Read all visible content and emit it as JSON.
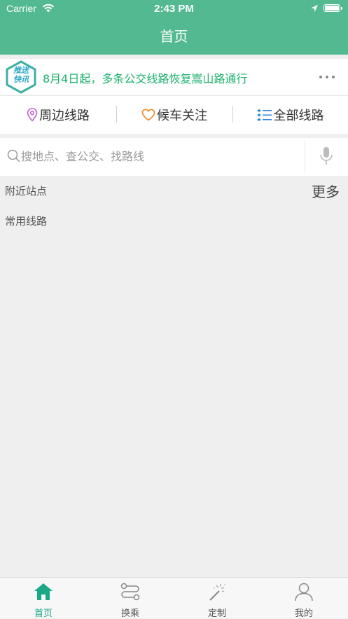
{
  "status_bar": {
    "carrier": "Carrier",
    "time": "2:43 PM"
  },
  "nav": {
    "title": "首页"
  },
  "notice": {
    "badge_line1": "推送",
    "badge_line2": "快讯",
    "text": "8月4日起，多条公交线路恢复嵩山路通行",
    "more": "•••"
  },
  "quick_links": [
    {
      "label": "周边线路",
      "icon": "location-pin-icon",
      "color": "#c45fd6"
    },
    {
      "label": "候车关注",
      "icon": "heart-icon",
      "color": "#f08b2a"
    },
    {
      "label": "全部线路",
      "icon": "list-icon",
      "color": "#2f7fd8"
    }
  ],
  "search": {
    "placeholder": "搜地点、查公交、找路线",
    "value": ""
  },
  "sections": {
    "nearby_title": "附近站点",
    "nearby_more": "更多",
    "routes_title": "常用线路"
  },
  "tabbar": [
    {
      "label": "首页",
      "icon": "home-icon",
      "active": true
    },
    {
      "label": "换乘",
      "icon": "transfer-icon",
      "active": false
    },
    {
      "label": "定制",
      "icon": "magic-wand-icon",
      "active": false
    },
    {
      "label": "我的",
      "icon": "user-icon",
      "active": false
    }
  ],
  "colors": {
    "primary": "#52b991",
    "notice_text": "#1ab26b",
    "tab_active": "#1aa987"
  }
}
